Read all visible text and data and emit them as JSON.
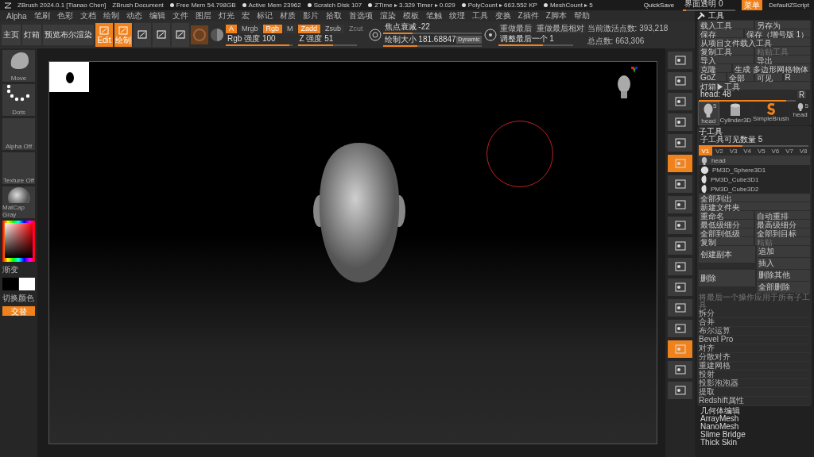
{
  "title_bar": {
    "app": "ZBrush 2024.0.1 [Tianao Chen]",
    "document": "ZBrush Document",
    "stats": [
      "Free Mem 54.798GB",
      "Active Mem 23962",
      "Scratch Disk 107",
      "ZTime ▸ 3.329 Timer ▸ 0.029",
      "PolyCount ▸ 663.552 KP",
      "MeshCount ▸ 5"
    ],
    "quicksave": "QuickSave",
    "transparency": {
      "label": "界面透明 0",
      "level": 0.05
    },
    "menu_button": "菜单",
    "script": "DefaultZScript"
  },
  "menu_bar": [
    "Alpha",
    "笔刷",
    "色彩",
    "文档",
    "绘制",
    "动态",
    "编辑",
    "文件",
    "图层",
    "灯光",
    "宏",
    "标记",
    "材质",
    "影片",
    "拾取",
    "首选项",
    "渲染",
    "模板",
    "笔触",
    "纹理",
    "工具",
    "变换",
    "Z插件",
    "Z脚本",
    "帮助"
  ],
  "toolbar": {
    "buttons": [
      "主页",
      "灯箱",
      "预览布尔渲染"
    ],
    "modes": [
      {
        "label": "Edit",
        "selected": true
      },
      {
        "label": "绘制",
        "selected": true
      },
      {
        "selected": false
      },
      {
        "selected": false
      },
      {
        "selected": false
      }
    ],
    "channels": [
      {
        "label": "A",
        "selected": true
      },
      {
        "label": "Mrgb",
        "selected": false
      },
      {
        "label": "Rgb",
        "selected": true
      },
      {
        "label": "M",
        "selected": false
      }
    ],
    "rgb_intensity": {
      "label": "Rgb 强度 100",
      "level": 0.95
    },
    "z_modes": [
      {
        "label": "Zadd",
        "selected": true,
        "disabled": false
      },
      {
        "label": "Zsub",
        "selected": false,
        "disabled": false
      },
      {
        "label": "Zcut",
        "disabled": true
      }
    ],
    "z_intensity": {
      "label": "Z 强度 51",
      "level": 0.6
    },
    "focal_shift": {
      "label": "焦点衰减 -22",
      "level": 0.3
    },
    "draw_size": {
      "label": "绘制大小 181.68847",
      "level": 0.35,
      "badge": "Dynamic"
    },
    "redo": [
      "重做最后",
      "重做最后相对"
    ],
    "adjust_last": {
      "label": "调整最后一个 1",
      "level": 0.6
    },
    "active_points": "当前激活点数: 393,218",
    "total_points": "总点数: 663,306"
  },
  "left_shelf": {
    "slots": [
      {
        "label": "Move",
        "kind": "brush"
      },
      {
        "label": "Dots",
        "kind": "stroke"
      },
      {
        "label": "Alpha Off",
        "kind": "empty"
      },
      {
        "label": "Texture Off",
        "kind": "empty"
      },
      {
        "label": "MatCap Gray",
        "kind": "material"
      }
    ],
    "gradient": "渐变",
    "swap": "切换颜色",
    "alternate": "交替"
  },
  "right_toolbar": [
    {
      "selected": false
    },
    {
      "selected": false
    },
    {
      "selected": false
    },
    {
      "selected": false
    },
    {
      "selected": false
    },
    {
      "selected": true
    },
    {
      "selected": false
    },
    {
      "selected": false
    },
    {
      "selected": false
    },
    {
      "selected": false
    },
    {
      "selected": false
    },
    {
      "selected": false
    },
    {
      "selected": false
    },
    {
      "selected": false
    },
    {
      "selected": true
    },
    {
      "selected": false
    },
    {
      "selected": false
    }
  ],
  "tool_panel": {
    "title": "工具",
    "button_rows": [
      [
        {
          "label": "载入工具",
          "disabled": false
        },
        {
          "label": "另存为",
          "disabled": false
        }
      ],
      [
        {
          "label": "保存",
          "disabled": false
        },
        {
          "label": "保存（增号版 1）",
          "disabled": false
        }
      ],
      [
        {
          "label": "从项目文件载入工具",
          "disabled": false
        }
      ],
      [
        {
          "label": "复制工具",
          "disabled": false
        },
        {
          "label": "粘贴工具",
          "disabled": true
        }
      ],
      [
        {
          "label": "导入",
          "disabled": false
        },
        {
          "label": "导出",
          "disabled": false
        }
      ],
      [
        {
          "label": "克隆",
          "disabled": false
        },
        {
          "label": "生成 多边形网格物体",
          "disabled": false
        }
      ],
      [
        {
          "label": "GoZ",
          "disabled": false
        },
        {
          "label": "全部",
          "disabled": false
        },
        {
          "label": "可见",
          "disabled": false
        },
        {
          "label": "R",
          "disabled": false
        }
      ],
      [
        {
          "label": "灯箱▶工具",
          "disabled": false
        }
      ]
    ],
    "head_slider": {
      "label": "head: 48",
      "level": 0.9,
      "button": "R"
    },
    "tools": [
      {
        "name": "head",
        "count": "5",
        "kind": "head",
        "selected": true
      },
      {
        "name": "Cylinder3D",
        "kind": "cylinder",
        "selected": false
      },
      {
        "name": "SimpleBrush",
        "kind": "brush",
        "selected": false
      },
      {
        "name": "head",
        "count": "5",
        "kind": "head",
        "selected": false
      }
    ],
    "subtool": {
      "title": "子工具",
      "visible_count": {
        "label": "子工具可见数量 5",
        "level": 0.4
      },
      "versions": [
        {
          "label": "V1",
          "selected": true
        },
        {
          "label": "V2",
          "selected": false
        },
        {
          "label": "V3",
          "selected": false
        },
        {
          "label": "V4",
          "selected": false
        },
        {
          "label": "V5",
          "selected": false
        },
        {
          "label": "V6",
          "selected": false
        },
        {
          "label": "V7",
          "selected": false
        },
        {
          "label": "V8",
          "selected": false
        }
      ],
      "items": [
        {
          "name": "head",
          "kind": "head",
          "selected": true
        },
        {
          "name": "PM3D_Sphere3D1",
          "kind": "sphere",
          "selected": false
        },
        {
          "name": "PM3D_Cube3D1",
          "kind": "ear",
          "selected": false
        },
        {
          "name": "PM3D_Cube3D2",
          "kind": "ear",
          "selected": false
        }
      ],
      "list_all": "全部列出",
      "new_folder": "新建文件夹",
      "button_rows": [
        [
          {
            "label": "重命名",
            "disabled": false
          },
          {
            "label": "自动重排",
            "disabled": false
          }
        ],
        [
          {
            "label": "最低级细分",
            "disabled": false
          },
          {
            "label": "最高级细分",
            "disabled": false
          }
        ],
        [
          {
            "label": "全部到低级",
            "disabled": false
          },
          {
            "label": "全部到目标",
            "disabled": false
          }
        ],
        [
          {
            "label": "复制",
            "disabled": false
          },
          {
            "label": "粘贴",
            "disabled": true
          }
        ]
      ],
      "duplicate": {
        "label": "创建副本",
        "options": [
          "追加",
          "插入"
        ]
      },
      "delete": {
        "label": "删除",
        "options": [
          "删除其他",
          "全部删除"
        ]
      },
      "note": "将最后一个操作应用于所有子工具",
      "sections": [
        "拆分",
        "合并",
        "布尔运算",
        "Bevel Pro",
        "对齐",
        "分散对齐",
        "重建网格",
        "投射",
        "投影泡泡器",
        "提取",
        "Redshift属性"
      ]
    }
  },
  "bottom_list": [
    "几何体编辑",
    "ArrayMesh",
    "NanoMesh",
    "Slime Bridge",
    "Thick Skin"
  ]
}
